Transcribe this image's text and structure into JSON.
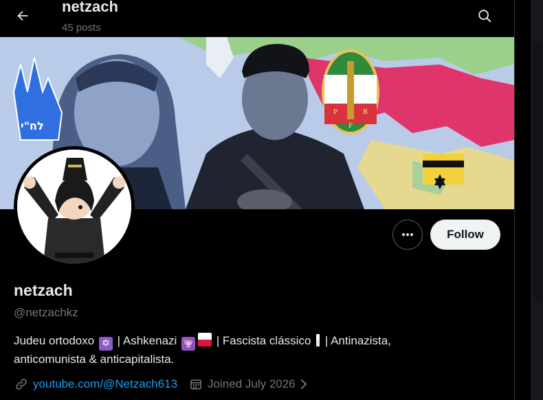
{
  "header": {
    "title": "netzach",
    "post_count": "45 posts"
  },
  "banner": {
    "badge_text": "לח\"י",
    "flag_letters": [
      "P",
      "R",
      "F"
    ]
  },
  "profile": {
    "display_name": "netzach",
    "handle": "@netzachkz",
    "bio": {
      "part1": "Judeu ortodoxo",
      "part2": "| Ashkenazi",
      "part3": "| Fascista clássico",
      "part4": "| Antinazista,",
      "line2": "anticomunista & anticapitalista."
    },
    "website": "youtube.com/@Netzach613",
    "joined": "Joined July 2026"
  },
  "actions": {
    "follow_label": "Follow"
  },
  "icons": [
    "back-arrow-icon",
    "search-icon",
    "more-icon",
    "link-icon",
    "calendar-icon",
    "chevron-right-icon"
  ],
  "colors": {
    "accent": "#1d9bf0",
    "muted": "#71767b",
    "text": "#e7e9ea",
    "follow_bg": "#eff3f4"
  }
}
